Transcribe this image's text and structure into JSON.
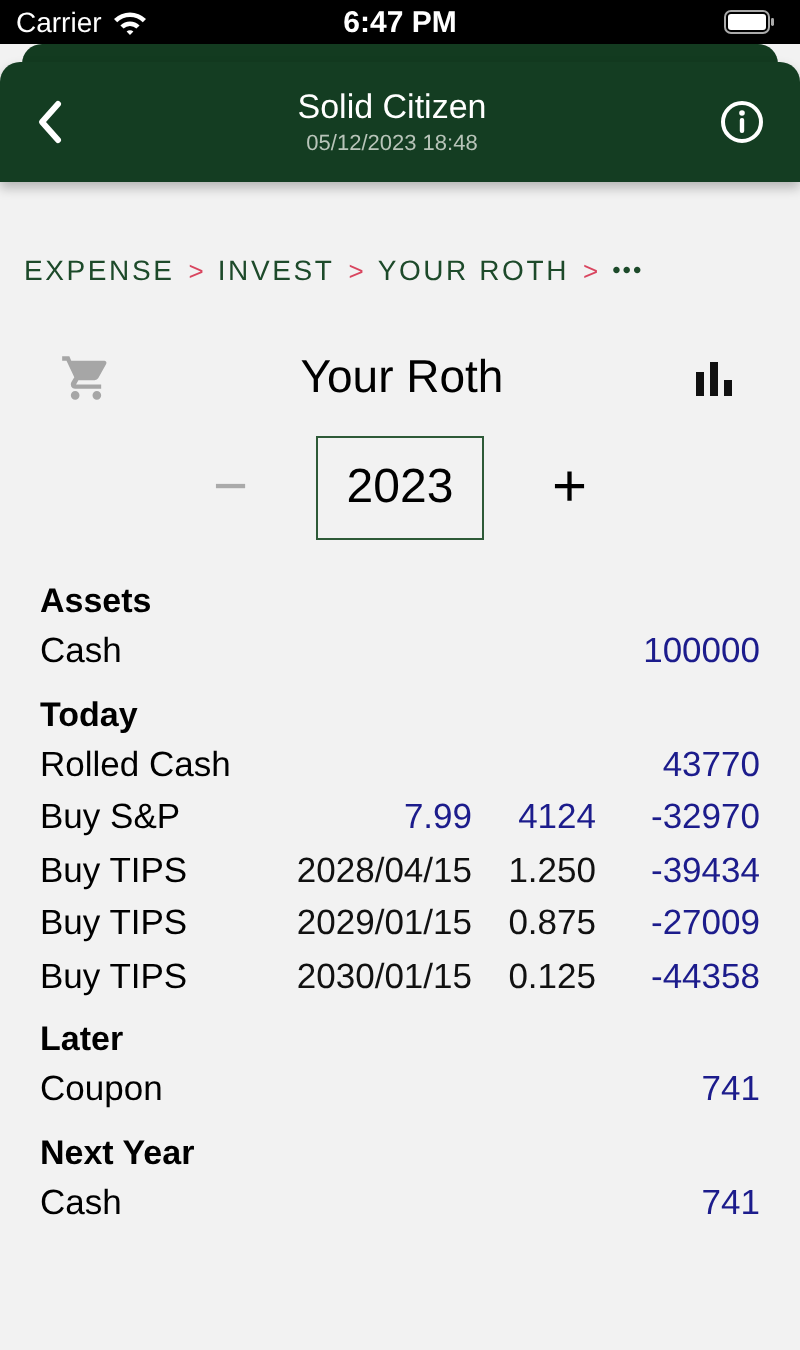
{
  "status_bar": {
    "carrier": "Carrier",
    "time": "6:47 PM"
  },
  "header": {
    "title": "Solid Citizen",
    "subtitle": "05/12/2023 18:48"
  },
  "breadcrumbs": [
    {
      "label": "EXPENSE",
      "separator": ">"
    },
    {
      "label": "INVEST",
      "separator": ">"
    },
    {
      "label": "YOUR ROTH",
      "separator": ">"
    }
  ],
  "breadcrumb_more": "•••",
  "toolbar": {
    "title": "Your Roth",
    "cart_disabled": true
  },
  "year_stepper": {
    "minus": "−",
    "minus_disabled": true,
    "value": "2023",
    "plus": "+",
    "plus_disabled": false
  },
  "sections": [
    {
      "title": "Assets",
      "rows": [
        {
          "label": "Cash",
          "cells": [
            {
              "text": ""
            },
            {
              "text": ""
            },
            {
              "text": "100000",
              "kind": "value"
            }
          ]
        }
      ]
    },
    {
      "title": "Today",
      "rows": [
        {
          "label": "Rolled Cash",
          "cells": [
            {
              "text": ""
            },
            {
              "text": ""
            },
            {
              "text": "43770",
              "kind": "value"
            }
          ]
        },
        {
          "label": "Buy S&P",
          "cells": [
            {
              "text": "7.99",
              "kind": "value"
            },
            {
              "text": "4124",
              "kind": "value"
            },
            {
              "text": "-32970",
              "kind": "value"
            }
          ]
        },
        {
          "label": "Buy TIPS",
          "cells": [
            {
              "text": "2028/04/15",
              "kind": "detail"
            },
            {
              "text": "1.250",
              "kind": "detail"
            },
            {
              "text": "-39434",
              "kind": "value"
            }
          ]
        },
        {
          "label": "Buy TIPS",
          "cells": [
            {
              "text": "2029/01/15",
              "kind": "detail"
            },
            {
              "text": "0.875",
              "kind": "detail"
            },
            {
              "text": "-27009",
              "kind": "value"
            }
          ]
        },
        {
          "label": "Buy TIPS",
          "cells": [
            {
              "text": "2030/01/15",
              "kind": "detail"
            },
            {
              "text": "0.125",
              "kind": "detail"
            },
            {
              "text": "-44358",
              "kind": "value"
            }
          ]
        }
      ]
    },
    {
      "title": "Later",
      "rows": [
        {
          "label": "Coupon",
          "cells": [
            {
              "text": ""
            },
            {
              "text": ""
            },
            {
              "text": "741",
              "kind": "value"
            }
          ]
        }
      ]
    },
    {
      "title": "Next Year",
      "rows": [
        {
          "label": "Cash",
          "cells": [
            {
              "text": ""
            },
            {
              "text": ""
            },
            {
              "text": "741",
              "kind": "value"
            }
          ]
        }
      ]
    }
  ]
}
